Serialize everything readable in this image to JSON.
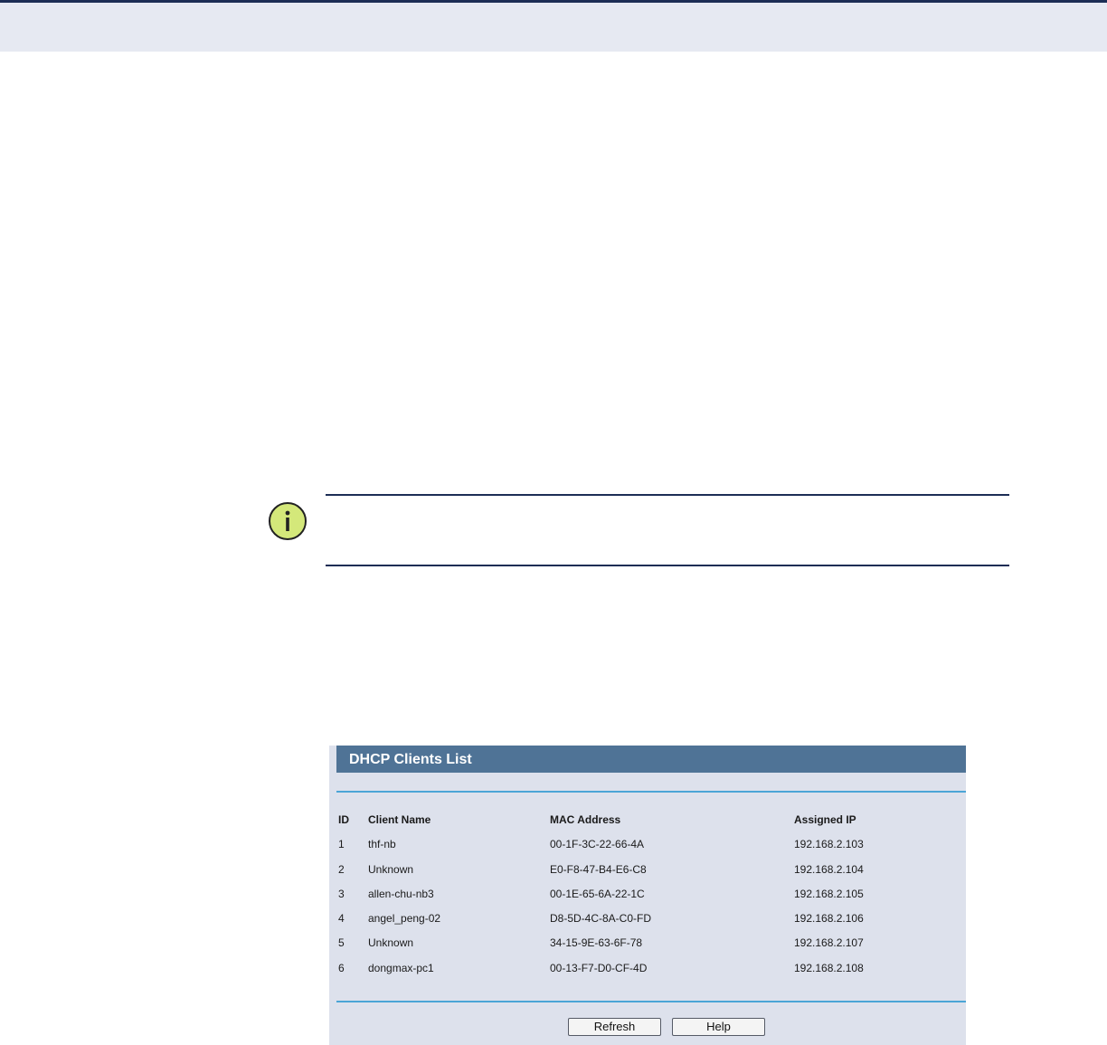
{
  "panel": {
    "title": "DHCP Clients List",
    "columns": {
      "id": "ID",
      "client_name": "Client Name",
      "mac_address": "MAC Address",
      "assigned_ip": "Assigned IP"
    },
    "rows": [
      {
        "id": "1",
        "client_name": "thf-nb",
        "mac_address": "00-1F-3C-22-66-4A",
        "assigned_ip": "192.168.2.103"
      },
      {
        "id": "2",
        "client_name": "Unknown",
        "mac_address": "E0-F8-47-B4-E6-C8",
        "assigned_ip": "192.168.2.104"
      },
      {
        "id": "3",
        "client_name": "allen-chu-nb3",
        "mac_address": "00-1E-65-6A-22-1C",
        "assigned_ip": "192.168.2.105"
      },
      {
        "id": "4",
        "client_name": "angel_peng-02",
        "mac_address": "D8-5D-4C-8A-C0-FD",
        "assigned_ip": "192.168.2.106"
      },
      {
        "id": "5",
        "client_name": "Unknown",
        "mac_address": "34-15-9E-63-6F-78",
        "assigned_ip": "192.168.2.107"
      },
      {
        "id": "6",
        "client_name": "dongmax-pc1",
        "mac_address": "00-13-F7-D0-CF-4D",
        "assigned_ip": "192.168.2.108"
      }
    ],
    "buttons": {
      "refresh_label": "Refresh",
      "help_label": "Help"
    }
  },
  "icons": {
    "note": "info-icon"
  },
  "colors": {
    "header_band": "#e6e9f2",
    "rule_navy": "#1c2d55",
    "panel_background": "#dde1ec",
    "panel_title_bar": "#4f7396",
    "panel_rule": "#4ba5d6",
    "info_icon_fill": "#d4e87a"
  }
}
